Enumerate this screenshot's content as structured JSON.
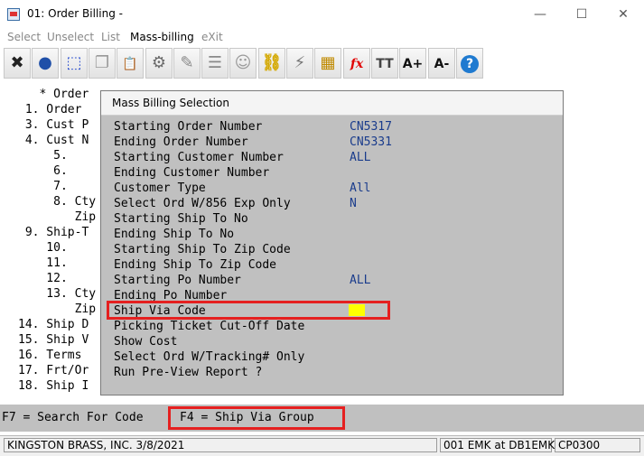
{
  "window": {
    "title": "01: Order Billing -",
    "controls": {
      "minimize": "—",
      "maximize": "☐",
      "close": "✕"
    }
  },
  "menu": [
    {
      "label": "Select",
      "active": false
    },
    {
      "label": "Unselect",
      "active": false
    },
    {
      "label": "List",
      "active": false
    },
    {
      "label": "Mass-billing",
      "active": true
    },
    {
      "label": "eXit",
      "active": false
    }
  ],
  "toolbar": [
    {
      "icon": "close-x-icon",
      "glyph": "✖",
      "color": "#222222"
    },
    {
      "icon": "globe-icon",
      "glyph": "●",
      "color": "#1f4fa8"
    },
    {
      "icon": "select-box-icon",
      "glyph": "⬚",
      "color": "#2a4fd0"
    },
    {
      "icon": "copy-icon",
      "glyph": "❐",
      "color": "#999999"
    },
    {
      "icon": "paste-icon",
      "glyph": "📋",
      "color": "#b08a3a"
    },
    {
      "icon": "gear-icon",
      "glyph": "⚙",
      "color": "#6a6a6a"
    },
    {
      "icon": "edit-icon",
      "glyph": "✎",
      "color": "#888888"
    },
    {
      "icon": "list-icon",
      "glyph": "☰",
      "color": "#8a8a8a"
    },
    {
      "icon": "users-icon",
      "glyph": "☺",
      "color": "#999999"
    },
    {
      "icon": "link-icon",
      "glyph": "⛓",
      "color": "#d4a800"
    },
    {
      "icon": "lightning-icon",
      "glyph": "⚡",
      "color": "#777777"
    },
    {
      "icon": "calendar-icon",
      "glyph": "▦",
      "color": "#c08a00"
    },
    {
      "icon": "function-icon",
      "glyph": "fx",
      "color": "#e00000"
    },
    {
      "icon": "font-size-icon",
      "glyph": "TT",
      "color": "#444444"
    },
    {
      "icon": "increase-font-icon",
      "glyph": "A+",
      "color": "#111111"
    },
    {
      "icon": "decrease-font-icon",
      "glyph": "A-",
      "color": "#111111"
    },
    {
      "icon": "help-icon",
      "glyph": "?",
      "color": "#1f7ad0"
    }
  ],
  "background_lines": [
    "   * Order",
    " 1. Order",
    " 3. Cust P",
    " 4. Cust N",
    "     5.",
    "     6.",
    "     7.",
    "     8. Cty",
    "        Zip",
    " 9. Ship-T",
    "    10.",
    "    11.",
    "    12.",
    "    13. Cty",
    "        Zip",
    "14. Ship D",
    "15. Ship V",
    "16. Terms",
    "17. Frt/Or",
    "18. Ship I"
  ],
  "dialog": {
    "title": "Mass Billing Selection",
    "fields": [
      {
        "label": "Starting Order Number",
        "value": "CN5317"
      },
      {
        "label": "Ending Order Number",
        "value": "CN5331"
      },
      {
        "label": "Starting Customer Number",
        "value": "ALL"
      },
      {
        "label": "Ending Customer Number",
        "value": ""
      },
      {
        "label": "Customer Type",
        "value": "All"
      },
      {
        "label": "Select Ord W/856 Exp Only",
        "value": "N"
      },
      {
        "label": "Starting Ship To No",
        "value": ""
      },
      {
        "label": "Ending Ship To No",
        "value": ""
      },
      {
        "label": "Starting Ship To Zip Code",
        "value": ""
      },
      {
        "label": "Ending Ship To Zip Code",
        "value": ""
      },
      {
        "label": "Starting Po Number",
        "value": "ALL"
      },
      {
        "label": "Ending Po Number",
        "value": ""
      },
      {
        "label": "Ship Via Code",
        "value": ""
      },
      {
        "label": "Picking Ticket Cut-Off Date",
        "value": ""
      },
      {
        "label": "Show Cost",
        "value": ""
      },
      {
        "label": "Select Ord W/Tracking# Only",
        "value": ""
      },
      {
        "label": "Run Pre-View Report ?",
        "value": ""
      }
    ]
  },
  "function_keys": {
    "f7": "F7 = Search For Code",
    "f4": "F4 = Ship Via Group"
  },
  "statusbar": {
    "company": "KINGSTON BRASS, INC. 3/8/2021",
    "session": "001 EMK at DB1EMK",
    "program": "CP0300"
  },
  "colors": {
    "highlight": "#e52020",
    "cursor": "#ffff00",
    "value_text": "#1a3c8c",
    "dialog_bg": "#c0c0c0"
  }
}
